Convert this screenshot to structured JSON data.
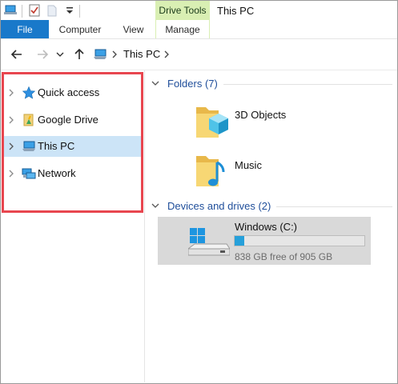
{
  "window": {
    "title": "This PC"
  },
  "ribbon": {
    "contextual_group": "Drive Tools",
    "tabs": [
      {
        "label": "File",
        "active": true
      },
      {
        "label": "Computer"
      },
      {
        "label": "View"
      },
      {
        "label": "Manage"
      }
    ]
  },
  "address": {
    "path": "This PC"
  },
  "navigation": {
    "items": [
      {
        "label": "Quick access",
        "icon": "star-icon"
      },
      {
        "label": "Google Drive",
        "icon": "google-drive-icon"
      },
      {
        "label": "This PC",
        "icon": "computer-icon",
        "selected": true
      },
      {
        "label": "Network",
        "icon": "network-icon"
      }
    ]
  },
  "content": {
    "folders_group": "Folders (7)",
    "folders": [
      {
        "label": "3D Objects",
        "icon": "3d-objects-folder-icon"
      },
      {
        "label": "Music",
        "icon": "music-folder-icon"
      }
    ],
    "devices_group": "Devices and drives (2)",
    "drive": {
      "name": "Windows (C:)",
      "free_text": "838 GB free of 905 GB",
      "used_fraction": 0.074,
      "bar_color": "#26a0da"
    }
  },
  "colors": {
    "file_tab": "#1979ca",
    "contextual_tab": "#d9efb3",
    "selection": "#cce4f7",
    "highlight_border": "#e8464f"
  }
}
